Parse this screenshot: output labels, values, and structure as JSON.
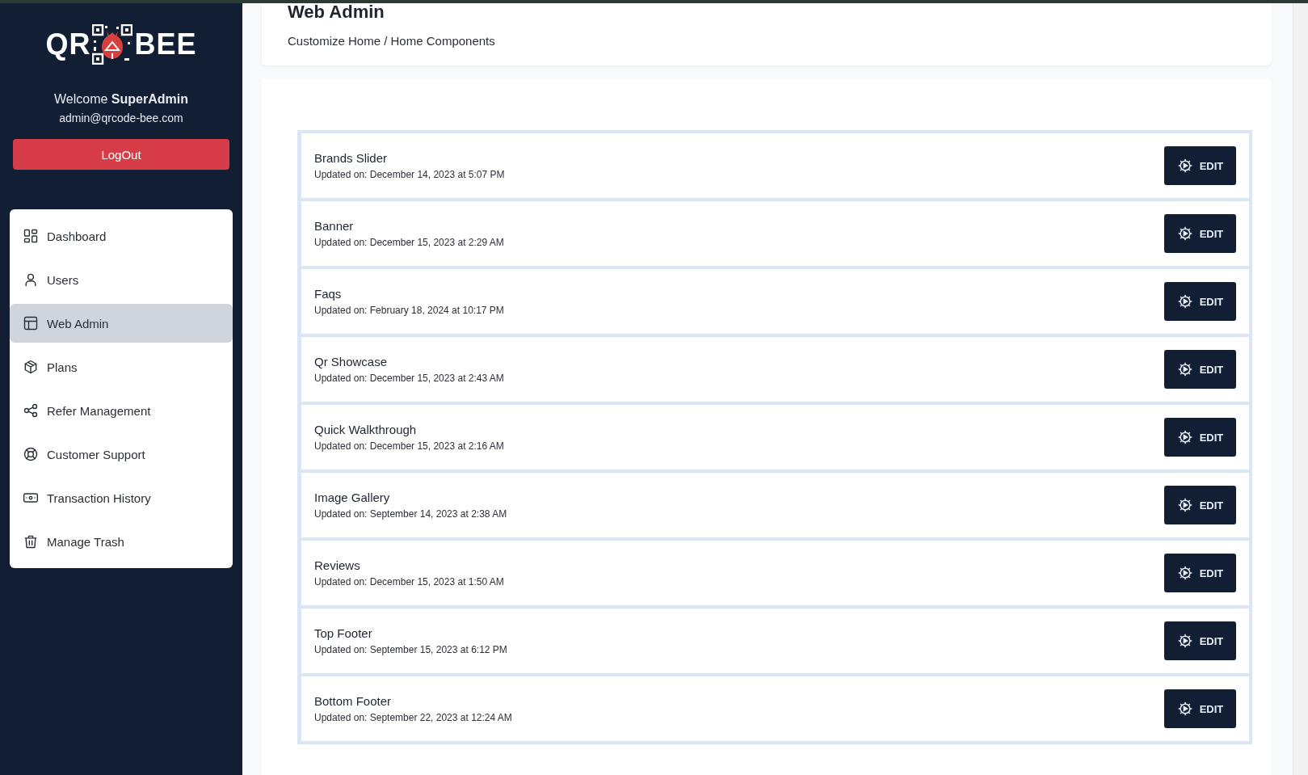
{
  "sidebar": {
    "logo": {
      "left": "QR",
      "right": "BEE"
    },
    "welcome": "Welcome **SuperAdmin**",
    "email": "admin@qrcode-bee.com",
    "logout": "LogOut",
    "items": [
      {
        "label": "Dashboard",
        "kind": "grid",
        "selected": false
      },
      {
        "label": "Users",
        "kind": "user",
        "selected": false
      },
      {
        "label": "Web Admin",
        "kind": "layout",
        "selected": true
      },
      {
        "label": "Plans",
        "kind": "box",
        "selected": false
      },
      {
        "label": "Refer Management",
        "kind": "share",
        "selected": false
      },
      {
        "label": "Customer Support",
        "kind": "lifebuoy",
        "selected": false
      },
      {
        "label": "Transaction History",
        "kind": "cash",
        "selected": false
      },
      {
        "label": "Manage Trash",
        "kind": "trash",
        "selected": false
      }
    ]
  },
  "header": {
    "title": "Web Admin",
    "breadcrumb": "Customize Home / Home Components"
  },
  "components": [
    {
      "name": "Brands Slider",
      "updated": "Updated on: December 14, 2023 at 5:07 PM",
      "action": "EDIT"
    },
    {
      "name": "Banner",
      "updated": "Updated on: December 15, 2023 at 2:29 AM",
      "action": "EDIT"
    },
    {
      "name": "Faqs",
      "updated": "Updated on: February 18, 2024 at 10:17 PM",
      "action": "EDIT"
    },
    {
      "name": "Qr Showcase",
      "updated": "Updated on: December 15, 2023 at 2:43 AM",
      "action": "EDIT"
    },
    {
      "name": "Quick Walkthrough",
      "updated": "Updated on: December 15, 2023 at 2:16 AM",
      "action": "EDIT"
    },
    {
      "name": "Image Gallery",
      "updated": "Updated on: September 14, 2023 at 2:38 AM",
      "action": "EDIT"
    },
    {
      "name": "Reviews",
      "updated": "Updated on: December 15, 2023 at 1:50 AM",
      "action": "EDIT"
    },
    {
      "name": "Top Footer",
      "updated": "Updated on: September 15, 2023 at 6:12 PM",
      "action": "EDIT"
    },
    {
      "name": "Bottom Footer",
      "updated": "Updated on: September 22, 2023 at 12:24 AM",
      "action": "EDIT"
    }
  ]
}
